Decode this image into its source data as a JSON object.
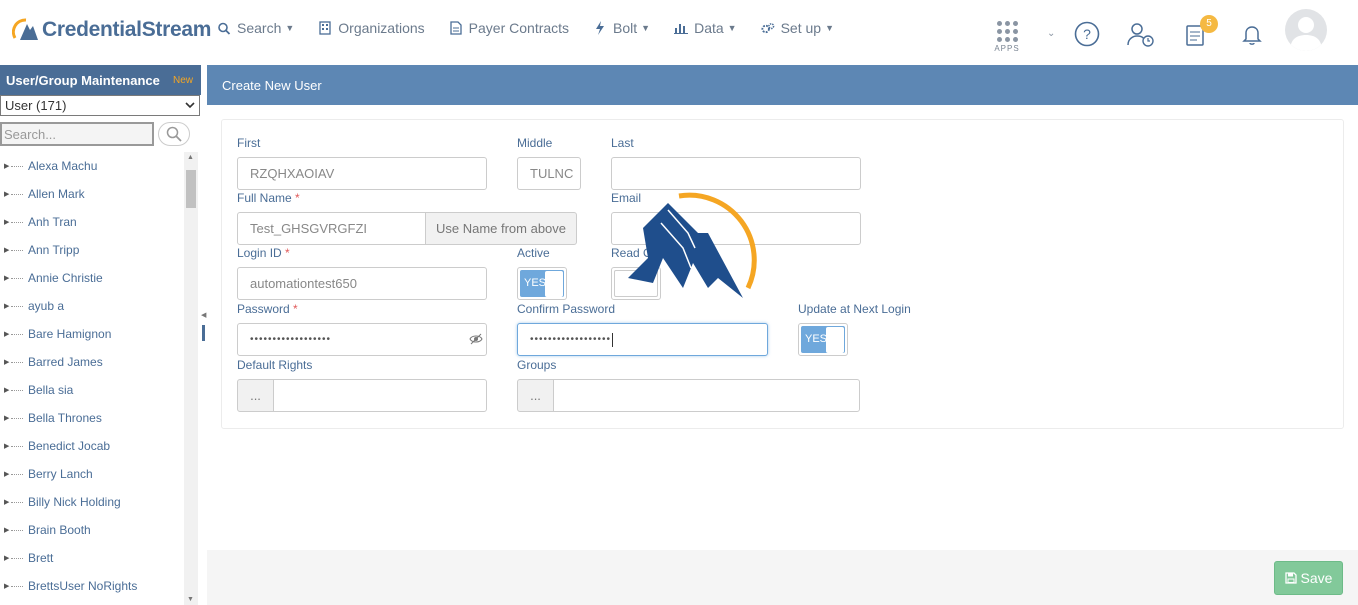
{
  "brand": {
    "name": "CredentialStream"
  },
  "nav": [
    {
      "label": "Search",
      "icon": "search-icon",
      "has_menu": true
    },
    {
      "label": "Organizations",
      "icon": "building-icon",
      "has_menu": false
    },
    {
      "label": "Payer Contracts",
      "icon": "document-icon",
      "has_menu": false
    },
    {
      "label": "Bolt",
      "icon": "bolt-icon",
      "has_menu": true
    },
    {
      "label": "Data",
      "icon": "bar-chart-icon",
      "has_menu": true
    },
    {
      "label": "Set up",
      "icon": "gears-icon",
      "has_menu": true
    }
  ],
  "apps_label": "APPS",
  "notification_count": "5",
  "sidebar": {
    "title": "User/Group Maintenance",
    "new_badge": "New",
    "select_value": "User (171)",
    "search_placeholder": "Search...",
    "items": [
      "Alexa Machu",
      "Allen Mark",
      "Anh Tran",
      "Ann Tripp",
      "Annie Christie",
      "ayub a",
      "Bare Hamignon",
      "Barred James",
      "Bella sia",
      "Bella Thrones",
      "Benedict Jocab",
      "Berry Lanch",
      "Billy Nick Holding",
      "Brain Booth",
      "Brett",
      "BrettsUser NoRights"
    ]
  },
  "form": {
    "header": "Create New User",
    "first_label": "First",
    "first_value": "RZQHXAOIAV",
    "middle_label": "Middle",
    "middle_value": "TULNC",
    "last_label": "Last",
    "last_value": "",
    "fullname_label": "Full Name",
    "fullname_value": "Test_GHSGVRGFZI",
    "use_name_button": "Use Name from above",
    "email_label": "Email",
    "email_value": "",
    "login_label": "Login ID",
    "login_value": "automationtest650",
    "active_label": "Active",
    "active_value": "YES",
    "readonly_label": "Read O",
    "password_label": "Password",
    "password_value": "••••••••••••••••••",
    "confirm_label": "Confirm Password",
    "confirm_value": "••••••••••••••••••",
    "update_label": "Update at Next Login",
    "update_value": "YES",
    "rights_label": "Default Rights",
    "groups_label": "Groups",
    "ellipsis": "...",
    "required_mark": "*"
  },
  "save_label": "Save",
  "colors": {
    "brand": "#4a6d96",
    "header": "#5d87b4",
    "toggle": "#6fa8dc",
    "save": "#82c99a",
    "badge": "#f5b942"
  }
}
